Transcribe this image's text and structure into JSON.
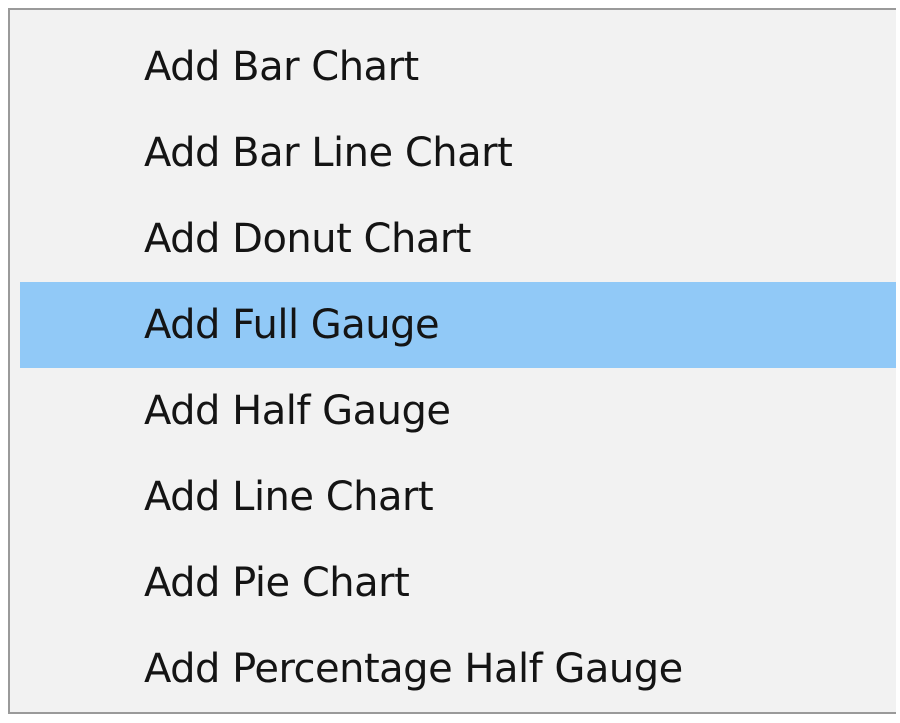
{
  "menu": {
    "highlight_color": "#91c9f7",
    "items": [
      {
        "label": "Add Bar Chart",
        "highlighted": false
      },
      {
        "label": "Add Bar Line Chart",
        "highlighted": false
      },
      {
        "label": "Add Donut Chart",
        "highlighted": false
      },
      {
        "label": "Add Full Gauge",
        "highlighted": true
      },
      {
        "label": "Add Half Gauge",
        "highlighted": false
      },
      {
        "label": "Add Line Chart",
        "highlighted": false
      },
      {
        "label": "Add Pie Chart",
        "highlighted": false
      },
      {
        "label": "Add Percentage Half Gauge",
        "highlighted": false
      }
    ]
  }
}
